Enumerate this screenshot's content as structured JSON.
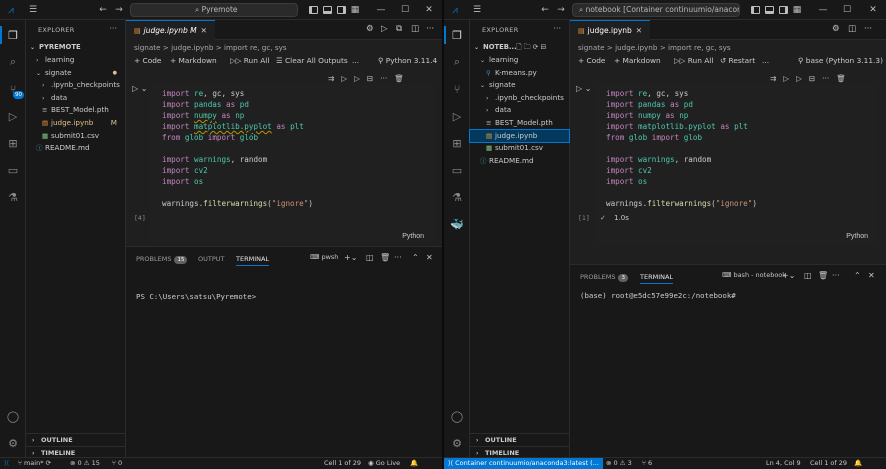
{
  "left": {
    "title_search": "Pyremote",
    "explorer_title": "EXPLORER",
    "root_folder": "PYREMOTE",
    "tree": [
      {
        "label": "learning",
        "kind": "folder",
        "depth": 1,
        "open": false
      },
      {
        "label": "signate",
        "kind": "folder",
        "depth": 1,
        "open": true,
        "status": "modified-dot"
      },
      {
        "label": ".ipynb_checkpoints",
        "kind": "folder",
        "depth": 2,
        "open": false
      },
      {
        "label": "data",
        "kind": "folder",
        "depth": 2,
        "open": false
      },
      {
        "label": "BEST_Model.pth",
        "kind": "file",
        "depth": 2
      },
      {
        "label": "judge.ipynb",
        "kind": "notebook",
        "depth": 2,
        "status": "M"
      },
      {
        "label": "submit01.csv",
        "kind": "csv",
        "depth": 2
      },
      {
        "label": "README.md",
        "kind": "info",
        "depth": 1
      }
    ],
    "outline": "OUTLINE",
    "timeline": "TIMELINE",
    "tab_label": "judge.ipynb M",
    "breadcrumb": "signate  >  judge.ipynb  >  import re, gc, sys",
    "toolbar": {
      "code": "+ Code",
      "markdown": "+ Markdown",
      "run_all": "Run All",
      "clear": "Clear All Outputs",
      "more": "...",
      "kernel": "Python 3.11.4"
    },
    "exec_count": "[4]",
    "lang": "Python",
    "panel_tabs": {
      "problems": "PROBLEMS",
      "problems_count": "15",
      "output": "OUTPUT",
      "terminal": "TERMINAL",
      "shell": "pwsh"
    },
    "terminal_prompt": "PS C:\\Users\\satsu\\Pyremote>",
    "status": {
      "branch": "main*",
      "errors": "0",
      "warnings": "15",
      "ports": "0",
      "cell": "Cell 1 of 29",
      "golive": "Go Live"
    }
  },
  "right": {
    "title_search": "notebook [Container continuumio/anaconda3:latest]",
    "explorer_title": "EXPLORER",
    "root_folder": "NOTEB...",
    "tree": [
      {
        "label": "learning",
        "kind": "folder",
        "depth": 1,
        "open": true
      },
      {
        "label": "K-means.py",
        "kind": "python",
        "depth": 2
      },
      {
        "label": "signate",
        "kind": "folder",
        "depth": 1,
        "open": true
      },
      {
        "label": ".ipynb_checkpoints",
        "kind": "folder",
        "depth": 2,
        "open": false
      },
      {
        "label": "data",
        "kind": "folder",
        "depth": 2,
        "open": false
      },
      {
        "label": "BEST_Model.pth",
        "kind": "file",
        "depth": 2
      },
      {
        "label": "judge.ipynb",
        "kind": "notebook",
        "depth": 2,
        "selected": true
      },
      {
        "label": "submit01.csv",
        "kind": "csv",
        "depth": 2
      },
      {
        "label": "README.md",
        "kind": "info",
        "depth": 1
      }
    ],
    "outline": "OUTLINE",
    "timeline": "TIMELINE",
    "tab_label": "judge.ipynb",
    "breadcrumb": "signate  >  judge.ipynb  >  import re, gc, sys",
    "toolbar": {
      "code": "+ Code",
      "markdown": "+ Markdown",
      "run_all": "Run All",
      "restart": "Restart",
      "more": "...",
      "kernel": "base (Python 3.11.3)"
    },
    "exec_count": "[1]",
    "exec_time": "1.0s",
    "lang": "Python",
    "panel_tabs": {
      "problems": "PROBLEMS",
      "problems_count": "3",
      "terminal": "TERMINAL",
      "shell": "bash - notebook"
    },
    "terminal_prompt": "(base) root@e5dc57e99e2c:/notebook#",
    "status": {
      "container": "Container continuumio/anaconda3:latest (...",
      "errors": "0",
      "warnings": "3",
      "ports": "6",
      "position": "Ln 4, Col 9",
      "cell": "Cell 1 of 29"
    }
  },
  "code_lines": [
    "import re, gc, sys",
    "import pandas as pd",
    "import numpy as np",
    "import matplotlib.pyplot as plt",
    "from glob import glob",
    "",
    "import warnings, random",
    "import cv2",
    "import os",
    "",
    "warnings.filterwarnings(\"ignore\")"
  ],
  "colors": {
    "accent": "#0078d4",
    "keyword": "#c586c0",
    "module": "#4ec9b0",
    "function": "#dcdcaa",
    "string": "#ce9178",
    "modified": "#e2c08d",
    "notebook_icon": "#f1a43c"
  }
}
